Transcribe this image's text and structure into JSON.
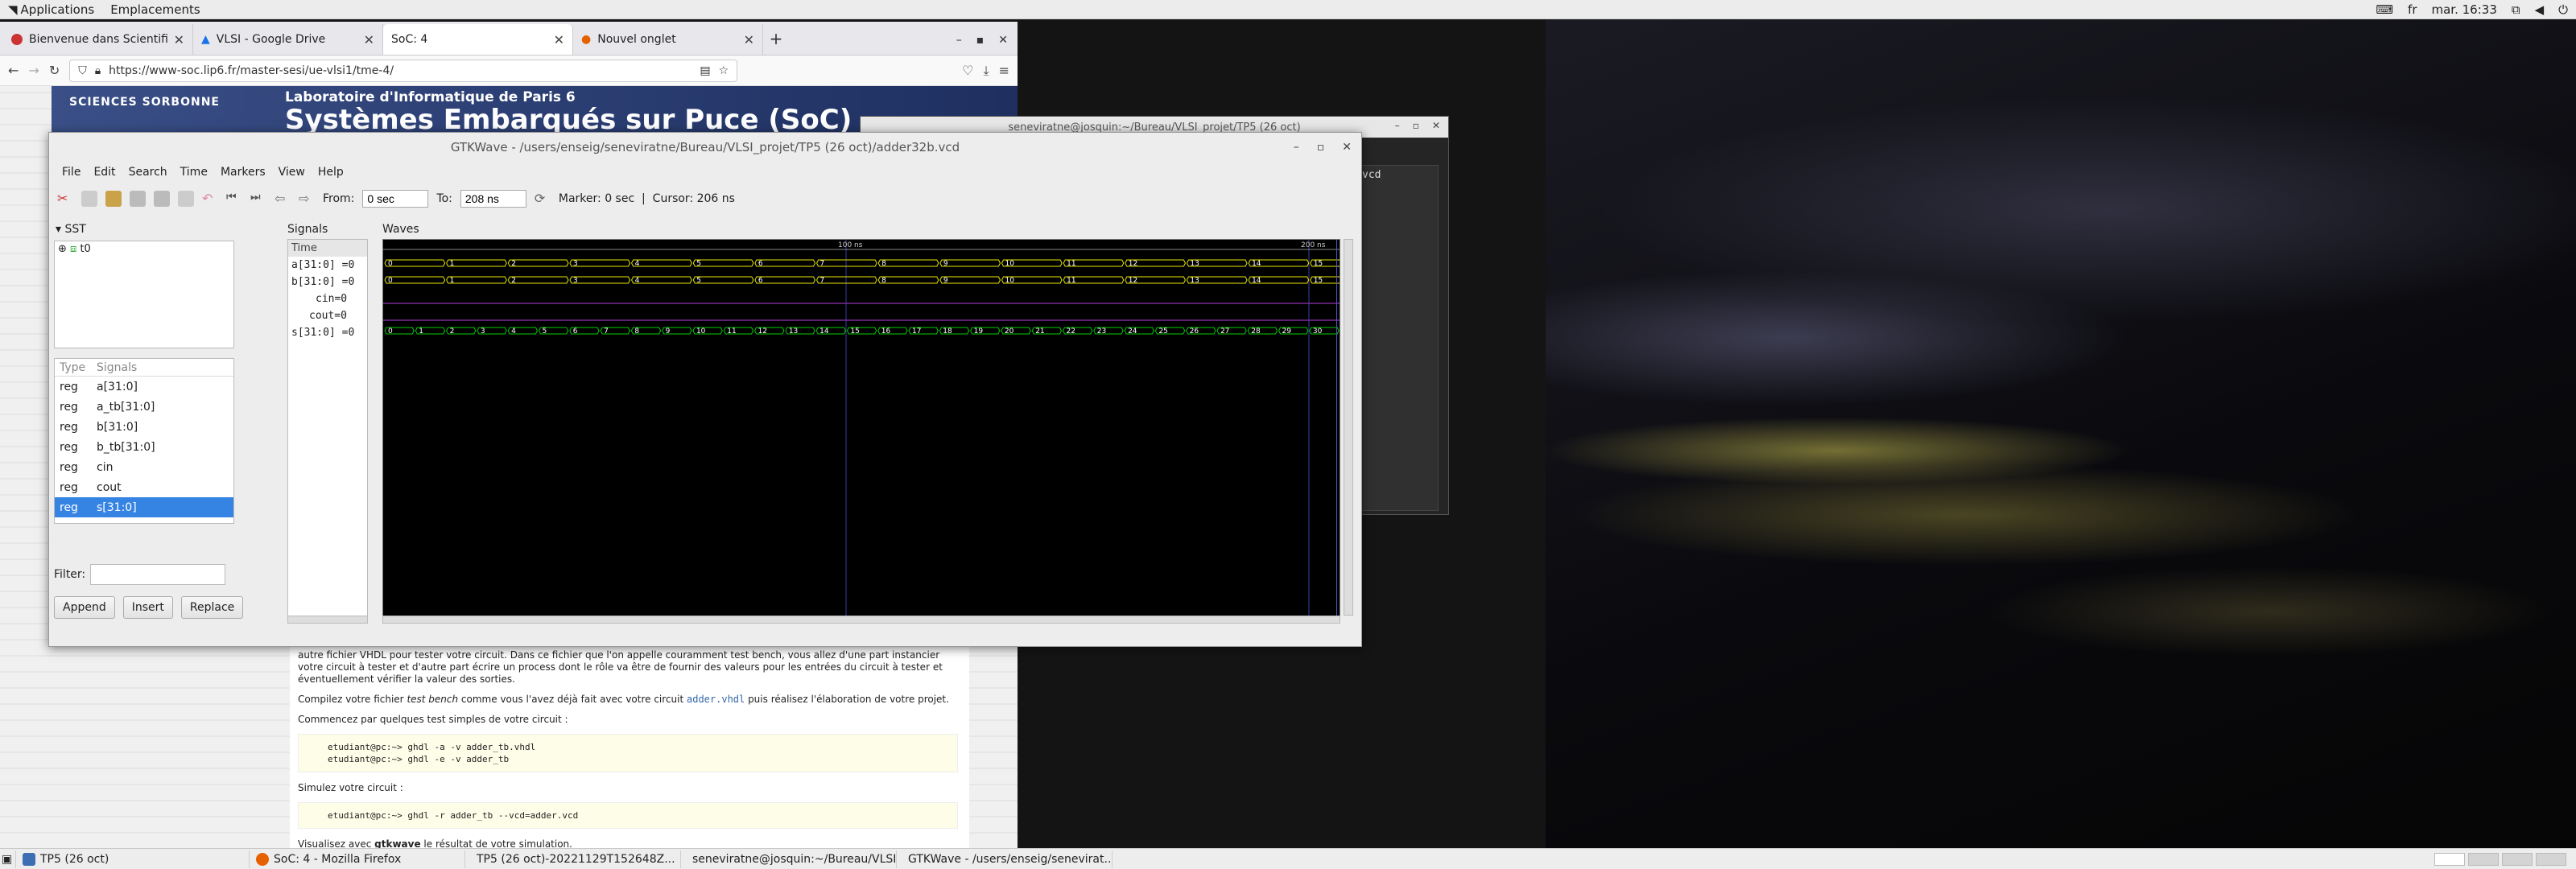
{
  "topbar": {
    "applications": "Applications",
    "places": "Emplacements",
    "lang": "fr",
    "clock": "mar. 16:33"
  },
  "firefox": {
    "tabs": [
      {
        "label": "Bienvenue dans Scientific Lin"
      },
      {
        "label": "VLSI - Google Drive"
      },
      {
        "label": "SoC: 4"
      },
      {
        "label": "Nouvel onglet"
      }
    ],
    "url": "https://www-soc.lip6.fr/master-sesi/ue-vlsi1/tme-4/",
    "banner": {
      "lab": "Laboratoire d'Informatique de Paris 6",
      "title": "Systèmes Embarqués sur Puce (SoC)",
      "logo": "SCIENCES SORBONNE"
    },
    "content": {
      "p1": "autre fichier VHDL pour tester votre circuit. Dans ce fichier que l'on appelle couramment test bench, vous allez d'une part instancier votre circuit à tester et d'autre part écrire un process dont le rôle va être de fournir des valeurs pour les entrées du circuit à tester et éventuellement vérifier la valeur des sorties.",
      "p2a": "Compilez votre fichier ",
      "p2b": "test bench",
      "p2c": " comme vous l'avez déjà fait avec votre circuit ",
      "p2d": "adder.vhdl",
      "p2e": " puis réalisez l'élaboration de votre projet.",
      "p3": "Commencez par quelques test simples de votre circuit :",
      "code1": "etudiant@pc:~> ghdl -a -v adder_tb.vhdl\netudiant@pc:~> ghdl -e -v adder_tb",
      "p4": "Simulez votre circuit :",
      "code2": "etudiant@pc:~> ghdl -r adder_tb --vcd=adder.vcd",
      "p5a": "Visualisez avec ",
      "p5b": "gtkwave",
      "p5c": " le résultat de votre simulation."
    }
  },
  "terminal": {
    "title": "seneviratne@josquin:~/Bureau/VLSI_projet/TP5 (26 oct)",
    "text": "vcd"
  },
  "gtkwave": {
    "title": "GTKWave - /users/enseig/seneviratne/Bureau/VLSI_projet/TP5 (26 oct)/adder32b.vcd",
    "menu": [
      "File",
      "Edit",
      "Search",
      "Time",
      "Markers",
      "View",
      "Help"
    ],
    "from_label": "From:",
    "from_value": "0 sec",
    "to_label": "To:",
    "to_value": "208 ns",
    "status": "Marker: 0 sec  |  Cursor: 206 ns",
    "sst_label": "SST",
    "tree_item": "t0",
    "type_header": "Type",
    "signals_header": "Signals",
    "signal_list": [
      {
        "type": "reg",
        "name": "a[31:0]"
      },
      {
        "type": "reg",
        "name": "a_tb[31:0]"
      },
      {
        "type": "reg",
        "name": "b[31:0]"
      },
      {
        "type": "reg",
        "name": "b_tb[31:0]"
      },
      {
        "type": "reg",
        "name": "cin"
      },
      {
        "type": "reg",
        "name": "cout"
      },
      {
        "type": "reg",
        "name": "s[31:0]"
      }
    ],
    "filter_label": "Filter:",
    "buttons": {
      "append": "Append",
      "insert": "Insert",
      "replace": "Replace"
    },
    "signals_pane_label": "Signals",
    "waves_pane_label": "Waves",
    "trace_names": [
      "Time",
      "a[31:0] =0",
      "b[31:0] =0",
      "cin=0",
      "cout=0",
      "s[31:0] =0"
    ],
    "time_markers": [
      "100 ns",
      "200 ns"
    ],
    "colors": {
      "bus": "#e6e600",
      "bus_s": "#00cc00",
      "single": "#7a2a99",
      "marker": "#3d3daa"
    }
  },
  "chart_data": {
    "type": "waveform",
    "time_range_ns": [
      0,
      208
    ],
    "time_markers": [
      "100 ns",
      "200 ns"
    ],
    "signals": [
      {
        "name": "a[31:0]",
        "values": [
          0,
          1,
          2,
          3,
          4,
          5,
          6,
          7,
          8,
          9,
          10,
          11,
          12,
          13,
          14,
          15
        ]
      },
      {
        "name": "b[31:0]",
        "values": [
          0,
          1,
          2,
          3,
          4,
          5,
          6,
          7,
          8,
          9,
          10,
          11,
          12,
          13,
          14,
          15
        ]
      },
      {
        "name": "cin",
        "values": [
          0
        ]
      },
      {
        "name": "cout",
        "values": [
          0
        ]
      },
      {
        "name": "s[31:0]",
        "values": [
          0,
          1,
          2,
          3,
          4,
          5,
          6,
          7,
          8,
          9,
          10,
          11,
          12,
          13,
          14,
          15,
          16,
          17,
          18,
          19,
          20,
          21,
          22,
          23,
          24,
          25,
          26,
          27,
          28,
          29,
          30
        ]
      }
    ]
  },
  "taskbar": [
    {
      "label": "TP5 (26 oct)"
    },
    {
      "label": "SoC: 4 - Mozilla Firefox"
    },
    {
      "label": "TP5 (26 oct)-20221129T152648Z..."
    },
    {
      "label": "seneviratne@josquin:~/Bureau/VLSI..."
    },
    {
      "label": "GTKWave - /users/enseig/senevirat..."
    }
  ]
}
